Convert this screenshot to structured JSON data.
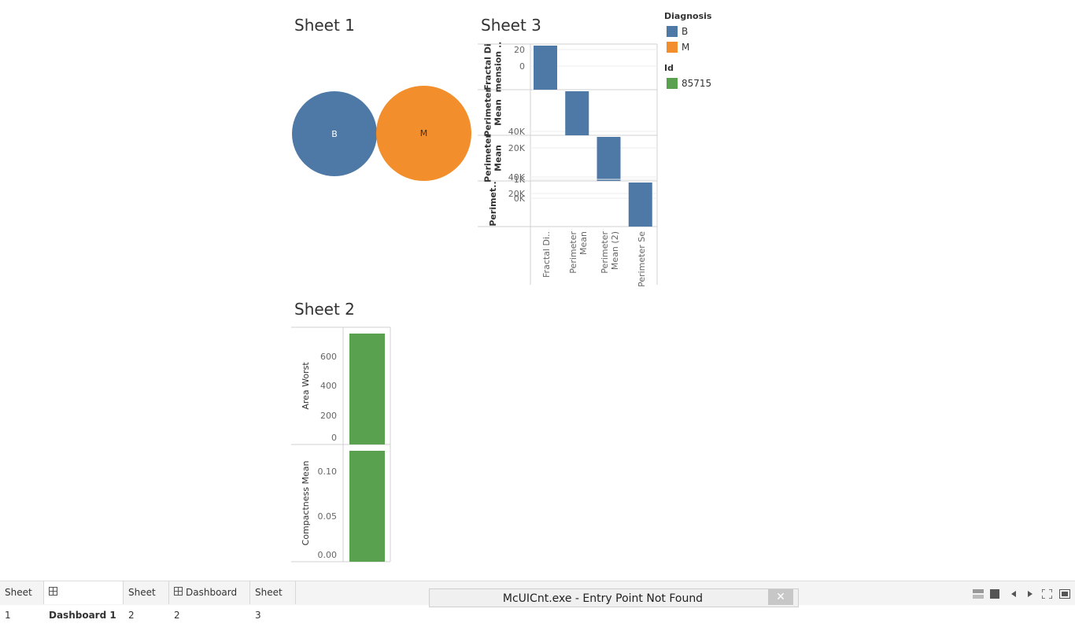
{
  "sheets": {
    "sheet1": {
      "title": "Sheet 1",
      "bubbles": [
        {
          "label": "B",
          "color": "#4e79a7"
        },
        {
          "label": "M",
          "color": "#f28e2b"
        }
      ]
    },
    "sheet3": {
      "title": "Sheet 3"
    },
    "sheet2": {
      "title": "Sheet 2"
    }
  },
  "legend": {
    "diagnosis_title": "Diagnosis",
    "diagnosis_items": [
      {
        "label": "B",
        "color": "#4e79a7"
      },
      {
        "label": "M",
        "color": "#f28e2b"
      }
    ],
    "id_title": "Id",
    "id_items": [
      {
        "label": "85715",
        "color": "#59a14f"
      }
    ]
  },
  "chart_data": [
    {
      "name": "Sheet 3",
      "type": "bar",
      "categories": [
        "Fractal Di..",
        "Perimeter Mean",
        "Perimeter Mean (2)",
        "Perimeter Se"
      ],
      "panels": [
        {
          "row_label": "Fractal Di mension ..",
          "ticks": [
            "20",
            "0"
          ],
          "bar_index": 0,
          "value": 42,
          "ylim": [
            0,
            42
          ]
        },
        {
          "row_label": "Perimeter Mean",
          "ticks": [
            "40K",
            "20K"
          ],
          "bar_index": 1,
          "value": 52000,
          "ylim": [
            0,
            52000
          ]
        },
        {
          "row_label": "Perimeter Mean",
          "ticks": [
            "40K",
            "20K"
          ],
          "bar_index": 2,
          "value": 52000,
          "ylim": [
            0,
            52000
          ]
        },
        {
          "row_label": "Perimet..",
          "ticks": [
            "1K",
            "0K"
          ],
          "bar_index": 3,
          "value": 2200,
          "ylim": [
            -400,
            2200
          ]
        }
      ],
      "color": "#4e79a7"
    },
    {
      "name": "Sheet 2",
      "type": "bar",
      "panels": [
        {
          "ylabel": "Area Worst",
          "ticks": [
            "600",
            "400",
            "200",
            "0"
          ],
          "value": 757,
          "ylim": [
            0,
            757
          ]
        },
        {
          "ylabel": "Compactness Mean",
          "ticks": [
            "0.10",
            "0.05",
            "0.00"
          ],
          "value": 0.124,
          "ylim": [
            0,
            0.124
          ]
        }
      ],
      "color": "#59a14f"
    }
  ],
  "tabs": [
    {
      "label": "Sheet 1",
      "icon": "none",
      "active": false
    },
    {
      "label": "Dashboard 1",
      "icon": "dashboard-icon",
      "active": true
    },
    {
      "label": "Sheet 2",
      "icon": "none",
      "active": false
    },
    {
      "label": "Dashboard 2",
      "icon": "dashboard-icon",
      "active": false
    },
    {
      "label": "Sheet 3",
      "icon": "none",
      "active": false
    }
  ],
  "error_bar": {
    "text": "McUICnt.exe - Entry Point Not Found",
    "close": "✕"
  }
}
